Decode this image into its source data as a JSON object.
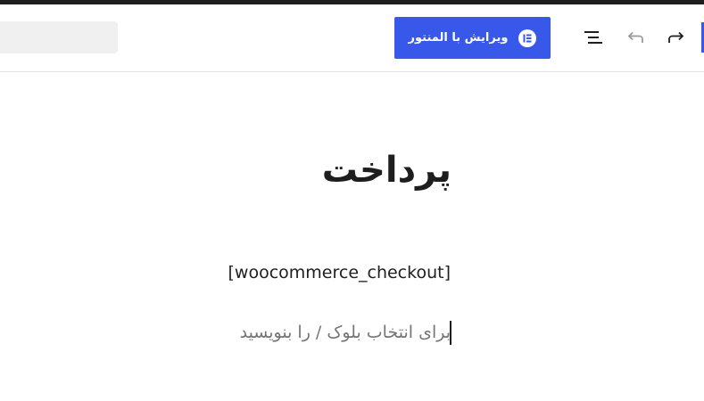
{
  "toolbar": {
    "search_placeholder": "",
    "elementor_button_label": "ویرایش با المنتور",
    "icons": {
      "elementor": "elementor-logo-icon",
      "list_view": "list-view-icon",
      "undo": "undo-icon",
      "redo": "redo-icon"
    },
    "accent_color": "#3858e9"
  },
  "editor": {
    "page_title": "پرداخت",
    "shortcode": "[woocommerce_checkout]",
    "block_placeholder": "برای انتخاب بلوک / را بنویسید"
  }
}
